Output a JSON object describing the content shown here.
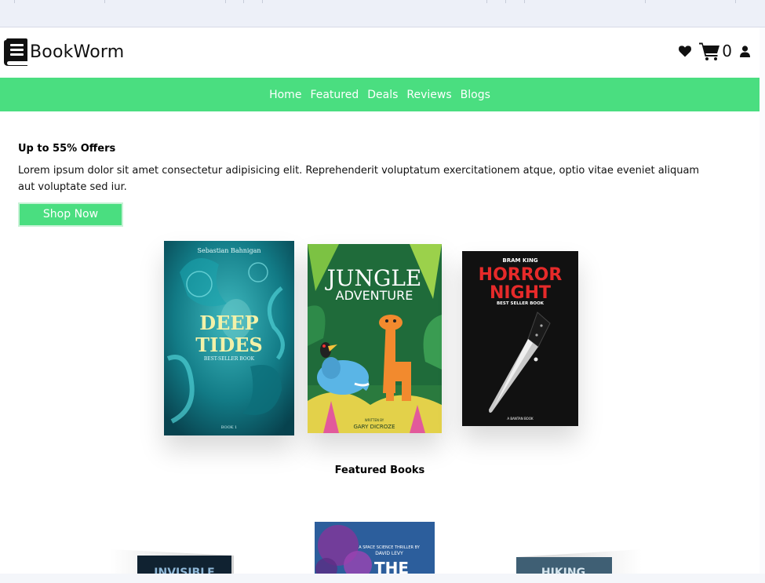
{
  "header": {
    "brand": "BookWorm",
    "cart_count": "0",
    "icons": [
      "heart-icon",
      "cart-icon",
      "user-icon",
      "book-logo-icon"
    ]
  },
  "nav": {
    "items": [
      "Home",
      "Featured",
      "Deals",
      "Reviews",
      "Blogs"
    ]
  },
  "hero": {
    "title": "Up to 55% Offers",
    "text": "Lorem ipsum dolor sit amet consectetur adipisicing elit. Reprehenderit voluptatum exercitationem atque, optio vitae eveniet aliquam aut voluptate sed iur.",
    "button": "Shop Now"
  },
  "books": [
    {
      "author": "Sebastian Bahnigan",
      "title_line1": "DEEP",
      "title_line2": "TIDES",
      "subtitle": "BEST-SELLER BOOK",
      "footer": "BOOK 1"
    },
    {
      "title_line1": "JUNGLE",
      "title_line2": "ADVENTURE",
      "written_by": "WRITTEN BY",
      "author": "GARY DICROZE"
    },
    {
      "author": "BRAM KING",
      "title_line1": "HORROR",
      "title_line2": "NIGHT",
      "subtitle": "BEST SELLER BOOK",
      "footer": "A BANTAN BOOK"
    }
  ],
  "featured": {
    "title": "Featured Books",
    "left_cover": "INVISIBLE",
    "center_tagline": "A SPACE SCIENCE THRILLER BY",
    "center_author": "DAVID LEVY",
    "center_title": "THE",
    "right_cover": "HIKING"
  },
  "colors": {
    "accent": "#4ade80",
    "button_border": "#c8f2d6"
  }
}
